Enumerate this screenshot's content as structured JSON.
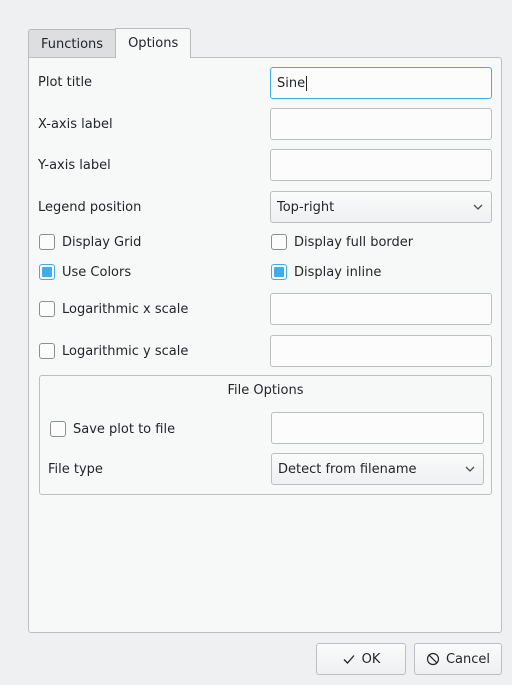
{
  "tabs": {
    "functions": "Functions",
    "options": "Options"
  },
  "options": {
    "plot_title_label": "Plot title",
    "plot_title_value": "Sine",
    "xaxis_label": "X-axis label",
    "xaxis_value": "",
    "yaxis_label": "Y-axis label",
    "yaxis_value": "",
    "legend_label": "Legend position",
    "legend_value": "Top-right",
    "display_grid": "Display Grid",
    "display_full_border": "Display full border",
    "use_colors": "Use Colors",
    "display_inline": "Display inline",
    "log_x": "Logarithmic x scale",
    "log_y": "Logarithmic y scale"
  },
  "checkbox_state": {
    "display_grid": false,
    "display_full_border": false,
    "use_colors": true,
    "display_inline": true,
    "log_x": false,
    "log_y": false,
    "save_plot": false
  },
  "file_options": {
    "title": "File Options",
    "save_label": "Save plot to file",
    "file_type_label": "File type",
    "file_type_value": "Detect from filename"
  },
  "buttons": {
    "ok": "OK",
    "cancel": "Cancel"
  },
  "colors": {
    "accent": "#3daee9",
    "background": "#eff0f1"
  },
  "icons": {
    "ok": "check-icon",
    "cancel": "cancel-icon",
    "dropdown": "chevron-down-icon"
  }
}
